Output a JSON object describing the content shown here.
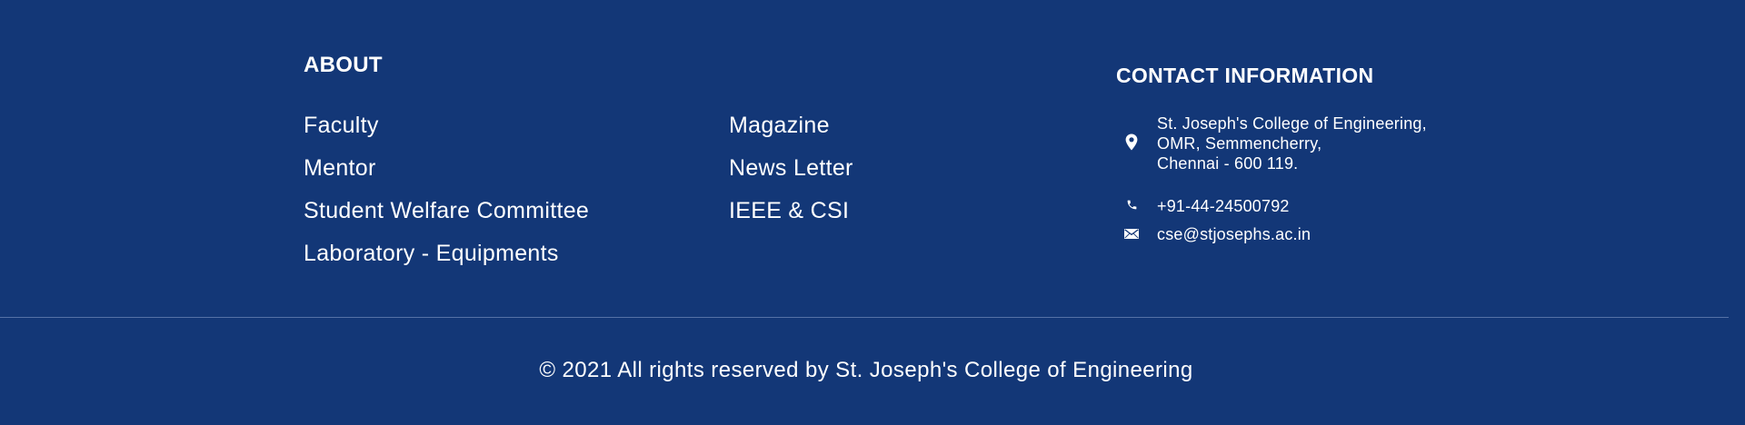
{
  "colors": {
    "background": "#133777",
    "text": "#ffffff",
    "divider": "#5571a6"
  },
  "about": {
    "heading": "ABOUT",
    "column_1": [
      {
        "label": "Faculty"
      },
      {
        "label": "Mentor"
      },
      {
        "label": "Student Welfare Committee"
      },
      {
        "label": "Laboratory - Equipments"
      }
    ],
    "column_2": [
      {
        "label": "Magazine"
      },
      {
        "label": "News Letter"
      },
      {
        "label": "IEEE & CSI"
      }
    ]
  },
  "contact": {
    "heading": "CONTACT INFORMATION",
    "address": {
      "icon": "location-pin-icon",
      "lines": [
        "St. Joseph's College of Engineering,",
        "OMR, Semmencherry,",
        "Chennai - 600 119."
      ]
    },
    "phone": {
      "icon": "phone-icon",
      "value": "+91-44-24500792"
    },
    "email": {
      "icon": "envelope-icon",
      "value": "cse@stjosephs.ac.in"
    }
  },
  "copyright": "© 2021 All rights reserved by St. Joseph's College of Engineering"
}
